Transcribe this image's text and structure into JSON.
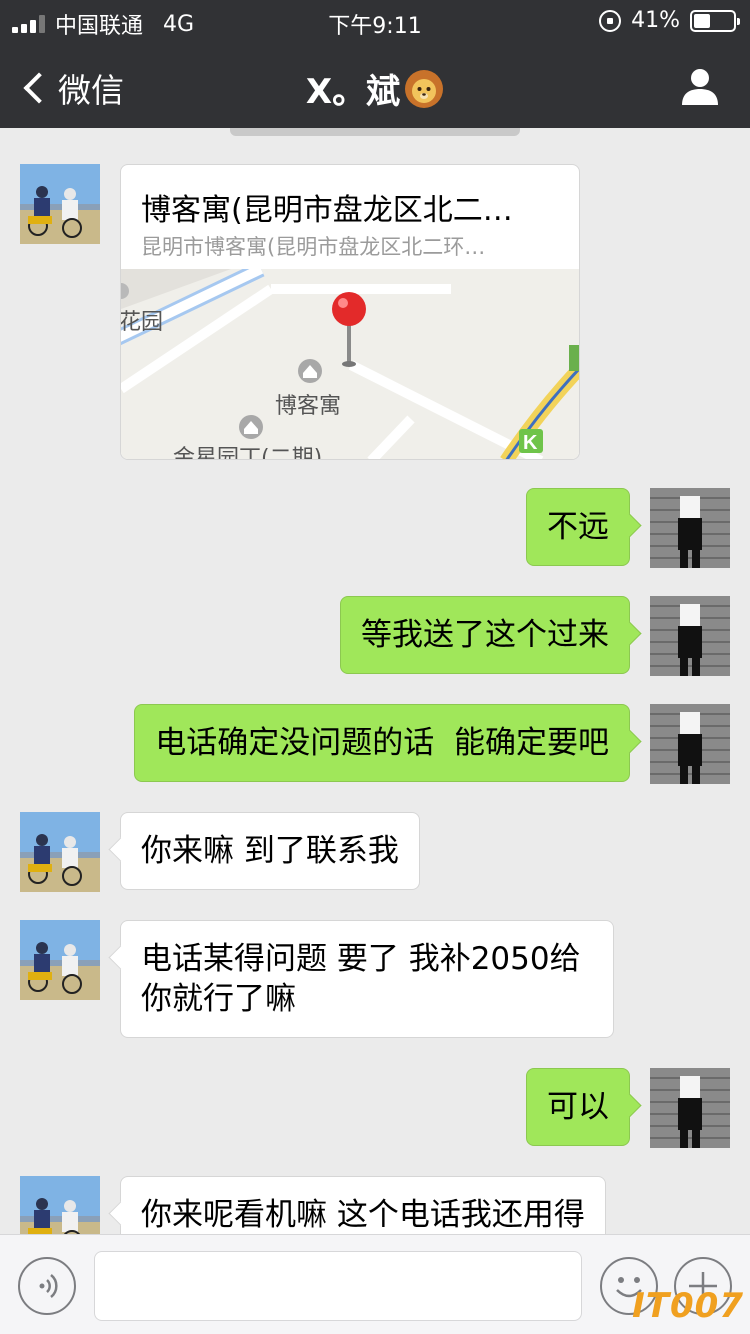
{
  "status_bar": {
    "carrier": "中国联通",
    "network": "4G",
    "time": "下午9:11",
    "battery": "41%",
    "battery_level": 0.41
  },
  "nav": {
    "back_label": "微信",
    "title": "X。斌"
  },
  "location": {
    "title": "博客寓(昆明市盘龙区北二…",
    "address": "昆明市博客寓(昆明市盘龙区北二环…",
    "map_labels": {
      "garden": "花园",
      "place": "博客寓",
      "partial": "金星园丁(二期)",
      "kfc": "K"
    }
  },
  "messages": [
    {
      "side": "right",
      "text": "不远"
    },
    {
      "side": "right",
      "text": "等我送了这个过来"
    },
    {
      "side": "right",
      "text": "电话确定没问题的话  能确定要吧"
    },
    {
      "side": "left",
      "text": "你来嘛 到了联系我"
    },
    {
      "side": "left",
      "line1": "电话某得问题 要了 我补2050给",
      "line2": "你就行了嘛"
    },
    {
      "side": "right",
      "text": "可以"
    },
    {
      "side": "left",
      "text": "你来呢看机嘛 这个电话我还用得"
    }
  ],
  "watermark": "IT007",
  "colors": {
    "nav_bg": "#313235",
    "chat_bg": "#ebebeb",
    "bubble_green": "#a0e75a",
    "bubble_white": "#ffffff"
  }
}
